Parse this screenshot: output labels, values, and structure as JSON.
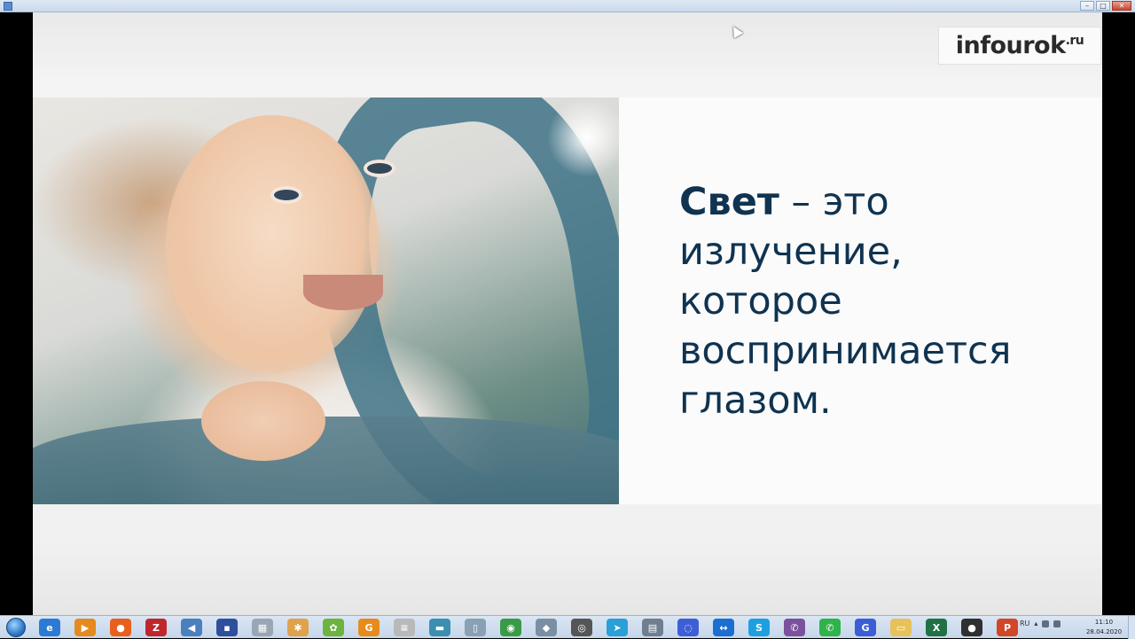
{
  "window": {
    "controls": [
      "–",
      "□",
      "✕"
    ]
  },
  "slide": {
    "logo": {
      "text": "infourok",
      "suffix": ".ru"
    },
    "statement": {
      "term": "Свет",
      "lines": [
        "– это",
        "излучение,",
        "которое",
        "воспринимается",
        "глазом."
      ]
    }
  },
  "taskbar": {
    "icons": [
      {
        "name": "ie-icon",
        "glyph": "e",
        "color": "#2b7ad4"
      },
      {
        "name": "media-player-icon",
        "glyph": "▶",
        "color": "#e48a1e"
      },
      {
        "name": "firefox-icon",
        "glyph": "●",
        "color": "#e8601c"
      },
      {
        "name": "filezilla-icon",
        "glyph": "Z",
        "color": "#c0272d"
      },
      {
        "name": "speaker-icon",
        "glyph": "◀",
        "color": "#4b7fc0"
      },
      {
        "name": "save-disk-icon",
        "glyph": "▪",
        "color": "#2f4f9c"
      },
      {
        "name": "calculator-icon",
        "glyph": "▦",
        "color": "#9aa6b4"
      },
      {
        "name": "network-icon",
        "glyph": "✱",
        "color": "#e0a24a"
      },
      {
        "name": "picasa-icon",
        "glyph": "✿",
        "color": "#6cb33f"
      },
      {
        "name": "gmail-icon",
        "glyph": "G",
        "color": "#e78b1c"
      },
      {
        "name": "notepad-icon",
        "glyph": "≡",
        "color": "#b9b9b9"
      },
      {
        "name": "scanner-icon",
        "glyph": "▬",
        "color": "#3c8fb0"
      },
      {
        "name": "recycle-bin-icon",
        "glyph": "▯",
        "color": "#8aa0b4"
      },
      {
        "name": "chrome-icon",
        "glyph": "◉",
        "color": "#3a9b47"
      },
      {
        "name": "gimp-icon",
        "glyph": "◆",
        "color": "#7b8fa4"
      },
      {
        "name": "camera-icon",
        "glyph": "◎",
        "color": "#555555"
      },
      {
        "name": "telegram-icon",
        "glyph": "➤",
        "color": "#2a9fd8"
      },
      {
        "name": "printer-icon",
        "glyph": "▤",
        "color": "#6f7f8f"
      },
      {
        "name": "messenger-icon",
        "glyph": "◌",
        "color": "#3d5fd6"
      },
      {
        "name": "teamviewer-icon",
        "glyph": "↔",
        "color": "#1b6fd0"
      },
      {
        "name": "skype-icon",
        "glyph": "S",
        "color": "#1ea0e0"
      },
      {
        "name": "viber-icon",
        "glyph": "✆",
        "color": "#7b519d"
      },
      {
        "name": "whatsapp-icon",
        "glyph": "✆",
        "color": "#2fb34a"
      },
      {
        "name": "chat-icon",
        "glyph": "G",
        "color": "#3b5ed7"
      },
      {
        "name": "folder-icon",
        "glyph": "▭",
        "color": "#e7c15a"
      },
      {
        "name": "excel-icon",
        "glyph": "X",
        "color": "#207245"
      },
      {
        "name": "obs-icon",
        "glyph": "●",
        "color": "#303030"
      },
      {
        "name": "powerpoint-icon",
        "glyph": "P",
        "color": "#d24726"
      }
    ],
    "tray": {
      "lang": "RU",
      "arrow": "▴"
    },
    "clock": {
      "time": "11:10",
      "date": "28.04.2020"
    }
  }
}
